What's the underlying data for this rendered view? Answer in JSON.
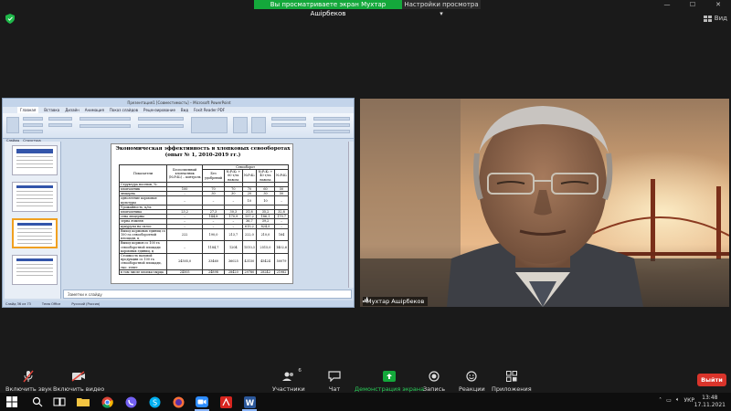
{
  "banner": {
    "sharing_text": "Вы просматриваете экран Мухтар Ашірбеков",
    "view_options": "Настройки просмотра",
    "view_label": "Вид"
  },
  "colors": {
    "share_green": "#14a83b",
    "leave_red": "#d9342b",
    "toolbar_bg": "#1a1a1a"
  },
  "ppt": {
    "title": "Презентация1 [Совместимость] – Microsoft PowerPoint",
    "tabs": [
      "Главная",
      "Вставка",
      "Дизайн",
      "Анимация",
      "Показ слайдов",
      "Рецензирование",
      "Вид",
      "Foxit Reader PDF"
    ],
    "panel_tabs": [
      "Слайды",
      "Структура"
    ],
    "notes_placeholder": "Заметки к слайду",
    "status": [
      "Слайд 36 из 73",
      "Тема Office",
      "Русский (Россия)"
    ],
    "slide": {
      "title": "Экономическая эффективность в хлопковых севооборотах",
      "subtitle": "(опыт № 1, 2010-2019 гг.)",
      "header_indicator": "Показатели",
      "header_control": "Беспочвенный хлопчатник (N₂P₂K₂) – контроль",
      "header_group": "Севооборот",
      "header_cols": [
        "Без удобрений",
        "N₂P₂K₂ + 60 т/га навоза",
        "N₂P₂K₂",
        "N₂P₂K₂ + 40 т/га навоза",
        "N₂P₂K₂"
      ],
      "rows": [
        {
          "label": "Структура посевов, %:",
          "values": [
            "",
            "",
            "",
            "",
            "",
            ""
          ]
        },
        {
          "label": "хлопчатник",
          "values": [
            "100",
            "70",
            "70",
            "70",
            "60",
            "50"
          ]
        },
        {
          "label": "люцерна",
          "values": [
            "–",
            "30",
            "30",
            "20",
            "30",
            "50"
          ]
        },
        {
          "label": "однолетние кормовые культуры",
          "values": [
            "–",
            "–",
            "–",
            "10",
            "10",
            "–"
          ]
        },
        {
          "label": "Урожайность, ц/га:",
          "values": [
            "",
            "",
            "",
            "",
            "",
            ""
          ]
        },
        {
          "label": "хлопчатника",
          "values": [
            "23,2",
            "27,3",
            "30,3",
            "31,8",
            "35,2",
            "32,8"
          ]
        },
        {
          "label": "сена люцерны",
          "values": [
            "–",
            "144,8",
            "170,9",
            "157,2",
            "186,1",
            "179,7"
          ]
        },
        {
          "label": "зерна ячменя",
          "values": [
            "–",
            "–",
            "–",
            "36,7",
            "39,2",
            "–"
          ]
        },
        {
          "label": "кукурузы на силос",
          "values": [
            "–",
            "–",
            "–",
            "615,2",
            "824,5",
            "–"
          ]
        },
        {
          "label": "Выход кормовых единиц со 100 га севооборотной площади, ц",
          "values": [
            "222",
            "190,0",
            "213,7",
            "222,0",
            "210,0",
            "164"
          ]
        },
        {
          "label": "Выход кормов со 100 га севооборотной площади кормовых единиц, ц",
          "values": [
            "–",
            "1184,7",
            "1204",
            "1510,3",
            "2515,0",
            "1402,6"
          ]
        },
        {
          "label": "Стоимость валовой продукции со 100 га севооборотной площади, тыс. тенге",
          "values": [
            "24505,0",
            "33460",
            "36025",
            "43150",
            "45424",
            "50079"
          ]
        },
        {
          "label": "в том числе хлопка-сырца",
          "values": [
            "24505",
            "24898",
            "28420",
            "29780",
            "28242",
            "21982"
          ]
        }
      ]
    }
  },
  "video": {
    "participant": "Мухтар Ашірбеков"
  },
  "toolbar": {
    "mute": "Включить звук",
    "video": "Включить видео",
    "participants": "Участники",
    "participants_count": "6",
    "chat": "Чат",
    "share": "Демонстрация экрана",
    "record": "Запись",
    "reactions": "Реакции",
    "apps": "Приложения",
    "leave": "Выйти"
  },
  "taskbar": {
    "lang": "УКР",
    "time": "13:48",
    "date": "17.11.2021",
    "apps": [
      "start-icon",
      "search-icon",
      "task-view-icon",
      "file-explorer-icon",
      "chrome-icon",
      "viber-icon",
      "skype-icon",
      "firefox-icon",
      "zoom-icon",
      "acrobat-icon",
      "word-icon"
    ]
  }
}
